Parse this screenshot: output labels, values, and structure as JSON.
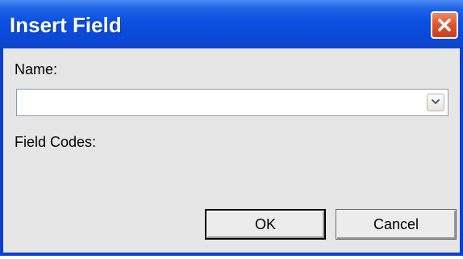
{
  "dialog": {
    "title": "Insert Field",
    "close_icon": "close-icon"
  },
  "name_field": {
    "label": "Name:",
    "value": "",
    "dropdown_icon": "chevron-down-icon"
  },
  "field_codes": {
    "label": "Field Codes:"
  },
  "buttons": {
    "ok_label": "OK",
    "cancel_label": "Cancel"
  },
  "colors": {
    "titlebar": "#0a4fe0",
    "close_button": "#e0522e",
    "dialog_background": "#e6e6e6",
    "title_text": "#ffffff"
  }
}
